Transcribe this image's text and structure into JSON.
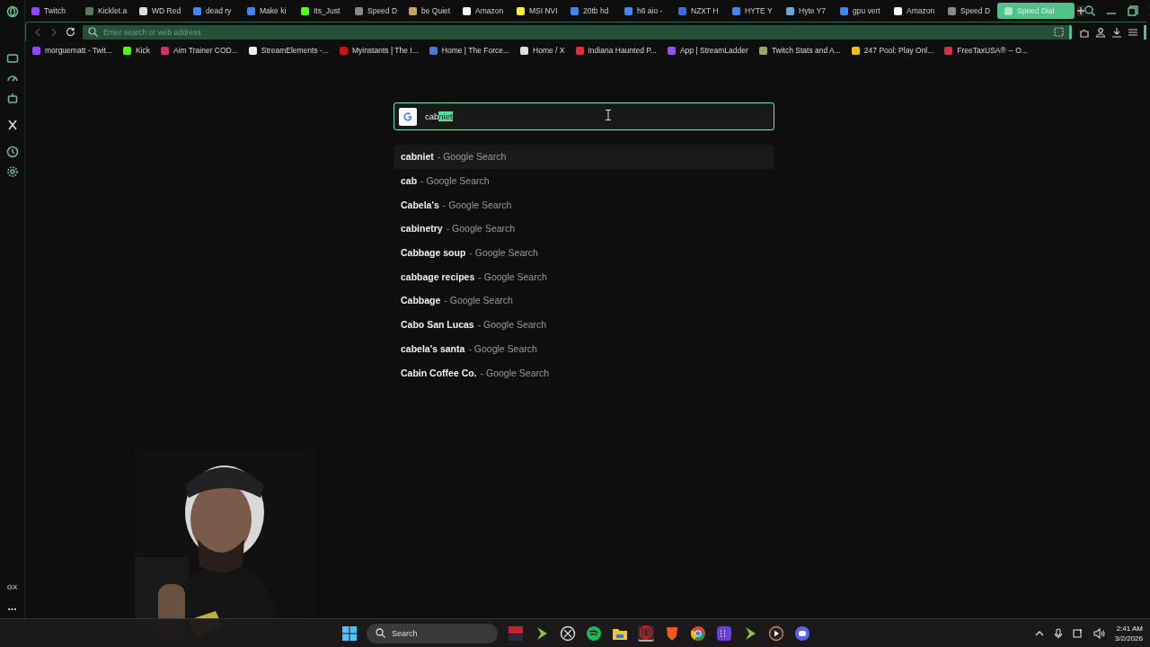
{
  "tabs": [
    {
      "label": "Twitch",
      "color": "#9146ff",
      "selected": false
    },
    {
      "label": "Kicklet.a",
      "color": "#5a7a5a",
      "selected": false
    },
    {
      "label": "WD Red",
      "color": "#dddddd",
      "selected": false
    },
    {
      "label": "dead ry",
      "color": "#4285f4",
      "selected": false
    },
    {
      "label": "Make ki",
      "color": "#4285f4",
      "selected": false
    },
    {
      "label": "Its_Just",
      "color": "#53fc18",
      "selected": false
    },
    {
      "label": "Speed D",
      "color": "#888888",
      "selected": false
    },
    {
      "label": "be Quiet",
      "color": "#c8a060",
      "selected": false
    },
    {
      "label": "Amazon",
      "color": "#ffffff",
      "selected": false
    },
    {
      "label": "MSI NVI",
      "color": "#ffee33",
      "selected": false
    },
    {
      "label": "20tb hd",
      "color": "#4285f4",
      "selected": false
    },
    {
      "label": "h6 aio -",
      "color": "#4285f4",
      "selected": false
    },
    {
      "label": "NZXT H",
      "color": "#3b6fe0",
      "selected": false
    },
    {
      "label": "HYTE Y",
      "color": "#4285f4",
      "selected": false
    },
    {
      "label": "Hyte Y7",
      "color": "#6aa8d8",
      "selected": false
    },
    {
      "label": "gpu vert",
      "color": "#4285f4",
      "selected": false
    },
    {
      "label": "Amazon",
      "color": "#ffffff",
      "selected": false
    },
    {
      "label": "Speed D",
      "color": "#888888",
      "selected": false
    },
    {
      "label": "Speed Dial",
      "color": "#a8e6c8",
      "selected": true
    }
  ],
  "address_bar": {
    "placeholder": "Enter search or web address"
  },
  "bookmarks": [
    {
      "label": "morguematt - Twit...",
      "color": "#9146ff"
    },
    {
      "label": "Kick",
      "color": "#53fc18"
    },
    {
      "label": "Aim Trainer COD...",
      "color": "#d0306a"
    },
    {
      "label": "StreamElements -...",
      "color": "#eeeeee"
    },
    {
      "label": "Myinstants | The I...",
      "color": "#cc1111"
    },
    {
      "label": "Home | The Force...",
      "color": "#4a7acc"
    },
    {
      "label": "Home / X",
      "color": "#dddddd"
    },
    {
      "label": "Indiana Haunted P...",
      "color": "#dd3333"
    },
    {
      "label": "App | StreamLadder",
      "color": "#8855ee"
    },
    {
      "label": "Twitch Stats and A...",
      "color": "#99aa66"
    },
    {
      "label": "247 Pool: Play Onl...",
      "color": "#e8c020"
    },
    {
      "label": "FreeTaxUSA® -- O...",
      "color": "#cc3344"
    }
  ],
  "search": {
    "typed": "cab",
    "completion": "niet"
  },
  "suggestions": [
    {
      "query": "cabniet",
      "source": "- Google Search",
      "selected": true
    },
    {
      "query": "cab",
      "source": "- Google Search",
      "selected": false
    },
    {
      "query": "Cabela's",
      "source": "- Google Search",
      "selected": false
    },
    {
      "query": "cabinetry",
      "source": "- Google Search",
      "selected": false
    },
    {
      "query": "Cabbage soup",
      "source": "- Google Search",
      "selected": false
    },
    {
      "query": "cabbage recipes",
      "source": "- Google Search",
      "selected": false
    },
    {
      "query": "Cabbage",
      "source": "- Google Search",
      "selected": false
    },
    {
      "query": "Cabo San Lucas",
      "source": "- Google Search",
      "selected": false
    },
    {
      "query": "cabela's santa",
      "source": "- Google Search",
      "selected": false
    },
    {
      "query": "Cabin Coffee Co.",
      "source": "- Google Search",
      "selected": false
    }
  ],
  "sidebar": {
    "badge": "GX",
    "more": "..."
  },
  "taskbar": {
    "search_placeholder": "Search",
    "time": "2:41 AM",
    "date": "3/2/2026"
  }
}
